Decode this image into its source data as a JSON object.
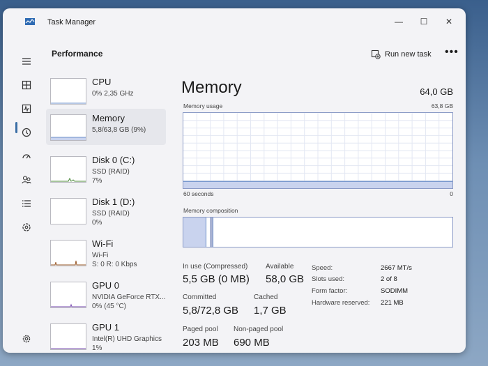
{
  "window": {
    "title": "Task Manager",
    "minimize": "—",
    "maximize": "☐",
    "close": "✕"
  },
  "nav": [
    "menu-icon",
    "processes-icon",
    "performance-icon",
    "app-history-icon",
    "startup-apps-icon",
    "users-icon",
    "details-icon",
    "services-icon",
    "settings-icon"
  ],
  "header": {
    "title": "Performance",
    "run_new_task": "Run new task",
    "more": "•••"
  },
  "list": [
    {
      "name": "CPU",
      "line1": "0% 2,35 GHz",
      "line2": ""
    },
    {
      "name": "Memory",
      "line1": "5,8/63,8 GB (9%)",
      "line2": ""
    },
    {
      "name": "Disk 0 (C:)",
      "line1": "SSD (RAID)",
      "line2": "7%"
    },
    {
      "name": "Disk 1 (D:)",
      "line1": "SSD (RAID)",
      "line2": "0%"
    },
    {
      "name": "Wi-Fi",
      "line1": "Wi-Fi",
      "line2": "S: 0 R: 0 Kbps"
    },
    {
      "name": "GPU 0",
      "line1": "NVIDIA GeForce RTX...",
      "line2": "0% (45 °C)"
    },
    {
      "name": "GPU 1",
      "line1": "Intel(R) UHD Graphics",
      "line2": "1%"
    }
  ],
  "memory": {
    "title": "Memory",
    "total": "64,0 GB",
    "usage_label": "Memory usage",
    "usage_max": "63,8 GB",
    "time_left": "60 seconds",
    "time_right": "0",
    "composition_label": "Memory composition",
    "in_use_fraction": 0.09,
    "stats": {
      "in_use_label": "In use (Compressed)",
      "in_use_value": "5,5 GB (0 MB)",
      "available_label": "Available",
      "available_value": "58,0 GB",
      "committed_label": "Committed",
      "committed_value": "5,8/72,8 GB",
      "cached_label": "Cached",
      "cached_value": "1,7 GB",
      "paged_label": "Paged pool",
      "paged_value": "203 MB",
      "nonpaged_label": "Non-paged pool",
      "nonpaged_value": "690 MB"
    },
    "props": {
      "speed_label": "Speed:",
      "speed_value": "2667 MT/s",
      "slots_label": "Slots used:",
      "slots_value": "2 of 8",
      "form_label": "Form factor:",
      "form_value": "SODIMM",
      "reserved_label": "Hardware reserved:",
      "reserved_value": "221 MB"
    }
  },
  "colors": {
    "accent": "#3a6ea5",
    "graph_border": "#8a9ac6",
    "memory_fill": "#c9d3ee"
  }
}
